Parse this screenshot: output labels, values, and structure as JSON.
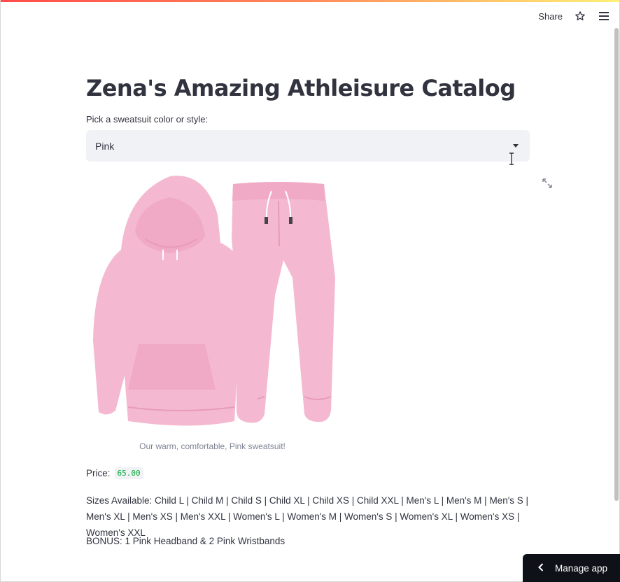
{
  "header": {
    "share_label": "Share"
  },
  "title": "Zena's Amazing Athleisure Catalog",
  "select": {
    "label": "Pick a sweatsuit color or style:",
    "value": "Pink"
  },
  "image": {
    "caption": "Our warm, comfortable, Pink sweatsuit!"
  },
  "price": {
    "label": "Price:",
    "value": "65.00"
  },
  "sizes": {
    "text": "Sizes Available: Child L | Child M | Child S | Child XL | Child XS | Child XXL | Men's L | Men's M | Men's S | Men's XL | Men's XS | Men's XXL | Women's L | Women's M | Women's S | Women's XL | Women's XS | Women's XXL"
  },
  "bonus": {
    "text": "BONUS: 1 Pink Headband & 2 Pink Wristbands"
  },
  "manage_app": {
    "label": "Manage app"
  },
  "colors": {
    "accent": "#ff4b4b",
    "sweatsuit": "#f4b9d0",
    "price_code": "#09ab3b"
  }
}
